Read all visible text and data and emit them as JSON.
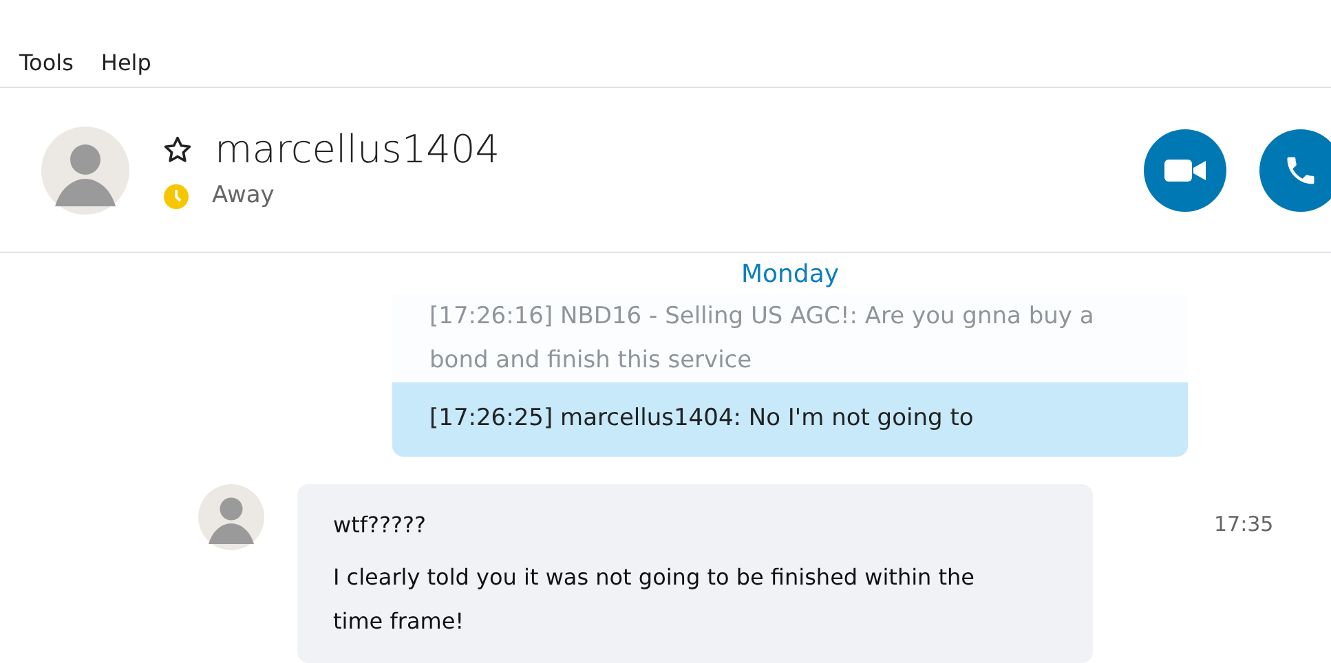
{
  "menu": [
    "Tools",
    "Help"
  ],
  "contact": {
    "name": "marcellus1404",
    "favorite": false,
    "status": "Away",
    "away": true
  },
  "day_divider": "Monday",
  "quoted_messages": [
    {
      "text": "[17:26:16] NBD16 - Selling US AGC!: Are you gnna buy a bond and finish this service",
      "faded": true
    },
    {
      "text": "[17:26:25] marcellus1404: No I'm not going to",
      "faded": false
    }
  ],
  "message": {
    "lines": [
      "wtf?????",
      "I clearly told you it was not going to be finished within the time frame!"
    ],
    "time": "17:35"
  }
}
